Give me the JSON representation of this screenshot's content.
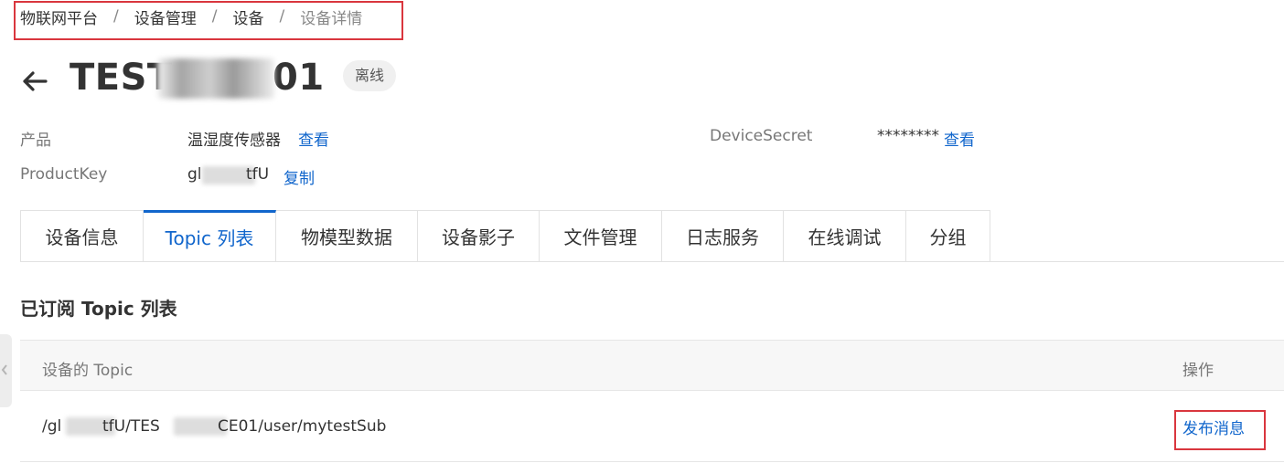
{
  "breadcrumb": {
    "items": [
      "物联网平台",
      "设备管理",
      "设备"
    ],
    "current": "设备详情",
    "separator": "/"
  },
  "header": {
    "title_prefix": "TEST",
    "title_suffix": "01",
    "status": "离线"
  },
  "meta": {
    "product_label": "产品",
    "product_value": "温湿度传感器",
    "product_link": "查看",
    "secret_label": "DeviceSecret",
    "secret_value": "********",
    "secret_link": "查看",
    "productkey_label": "ProductKey",
    "productkey_value_start": "gl",
    "productkey_value_end": "tfU",
    "productkey_copy": "复制"
  },
  "tabs": [
    {
      "label": "设备信息",
      "active": false
    },
    {
      "label": "Topic 列表",
      "active": true
    },
    {
      "label": "物模型数据",
      "active": false
    },
    {
      "label": "设备影子",
      "active": false
    },
    {
      "label": "文件管理",
      "active": false
    },
    {
      "label": "日志服务",
      "active": false
    },
    {
      "label": "在线调试",
      "active": false
    },
    {
      "label": "分组",
      "active": false
    }
  ],
  "section_title": "已订阅 Topic 列表",
  "table": {
    "col_topic": "设备的 Topic",
    "col_action": "操作",
    "rows": [
      {
        "topic_start": "/gl",
        "topic_mid": "tfU/TES",
        "topic_end": "CE01/user/mytestSub",
        "action": "发布消息"
      }
    ]
  },
  "colors": {
    "accent": "#1166cc",
    "annotation_red": "#d9363e"
  }
}
